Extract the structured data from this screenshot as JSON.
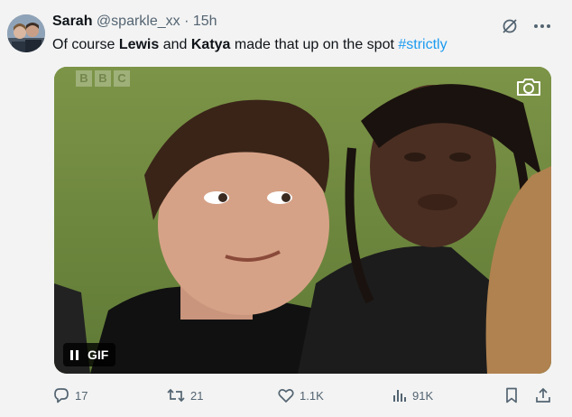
{
  "tweet": {
    "display_name": "Sarah",
    "handle": "@sparkle_xx",
    "separator": "·",
    "time": "15h",
    "text_parts": {
      "t1": "Of course ",
      "b1": "Lewis",
      "t2": " and ",
      "b2": "Katya",
      "t3": " made that up on the spot ",
      "hashtag": "#strictly"
    }
  },
  "media": {
    "type": "GIF",
    "badge_label": "GIF",
    "watermark": [
      "B",
      "B",
      "C"
    ]
  },
  "actions": {
    "replies": "17",
    "reposts": "21",
    "likes": "1.1K",
    "views": "91K"
  },
  "colors": {
    "accent": "#1d9bf0",
    "text": "#0f1419",
    "muted": "#536471",
    "background": "#f3f3f3"
  },
  "icons": [
    "grok-icon",
    "more-icon",
    "camera-icon",
    "pause-icon",
    "reply-icon",
    "repost-icon",
    "like-icon",
    "views-icon",
    "bookmark-icon",
    "share-icon"
  ]
}
